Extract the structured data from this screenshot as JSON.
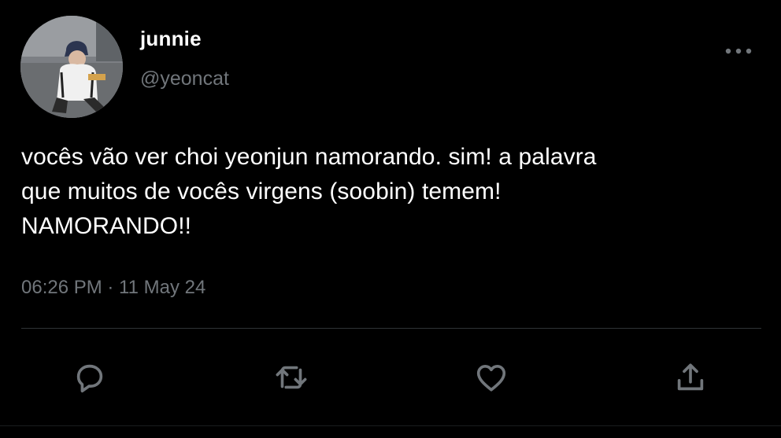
{
  "tweet": {
    "author": {
      "display_name": "junnie",
      "handle": "@yeoncat",
      "avatar_icon": "profile-photo"
    },
    "text": "vocês vão ver choi yeonjun namorando. sim! a palavra\nque muitos de vocês virgens (soobin) temem!\nNAMORANDO!!",
    "timestamp": "06:26 PM · 11 May 24",
    "actions": [
      "reply-icon",
      "retweet-icon",
      "like-icon",
      "share-icon"
    ],
    "more_icon": "more-options-icon"
  },
  "colors": {
    "background": "#000000",
    "primary_text": "#ffffff",
    "secondary_text": "#71767b",
    "divider": "#2f3336"
  }
}
